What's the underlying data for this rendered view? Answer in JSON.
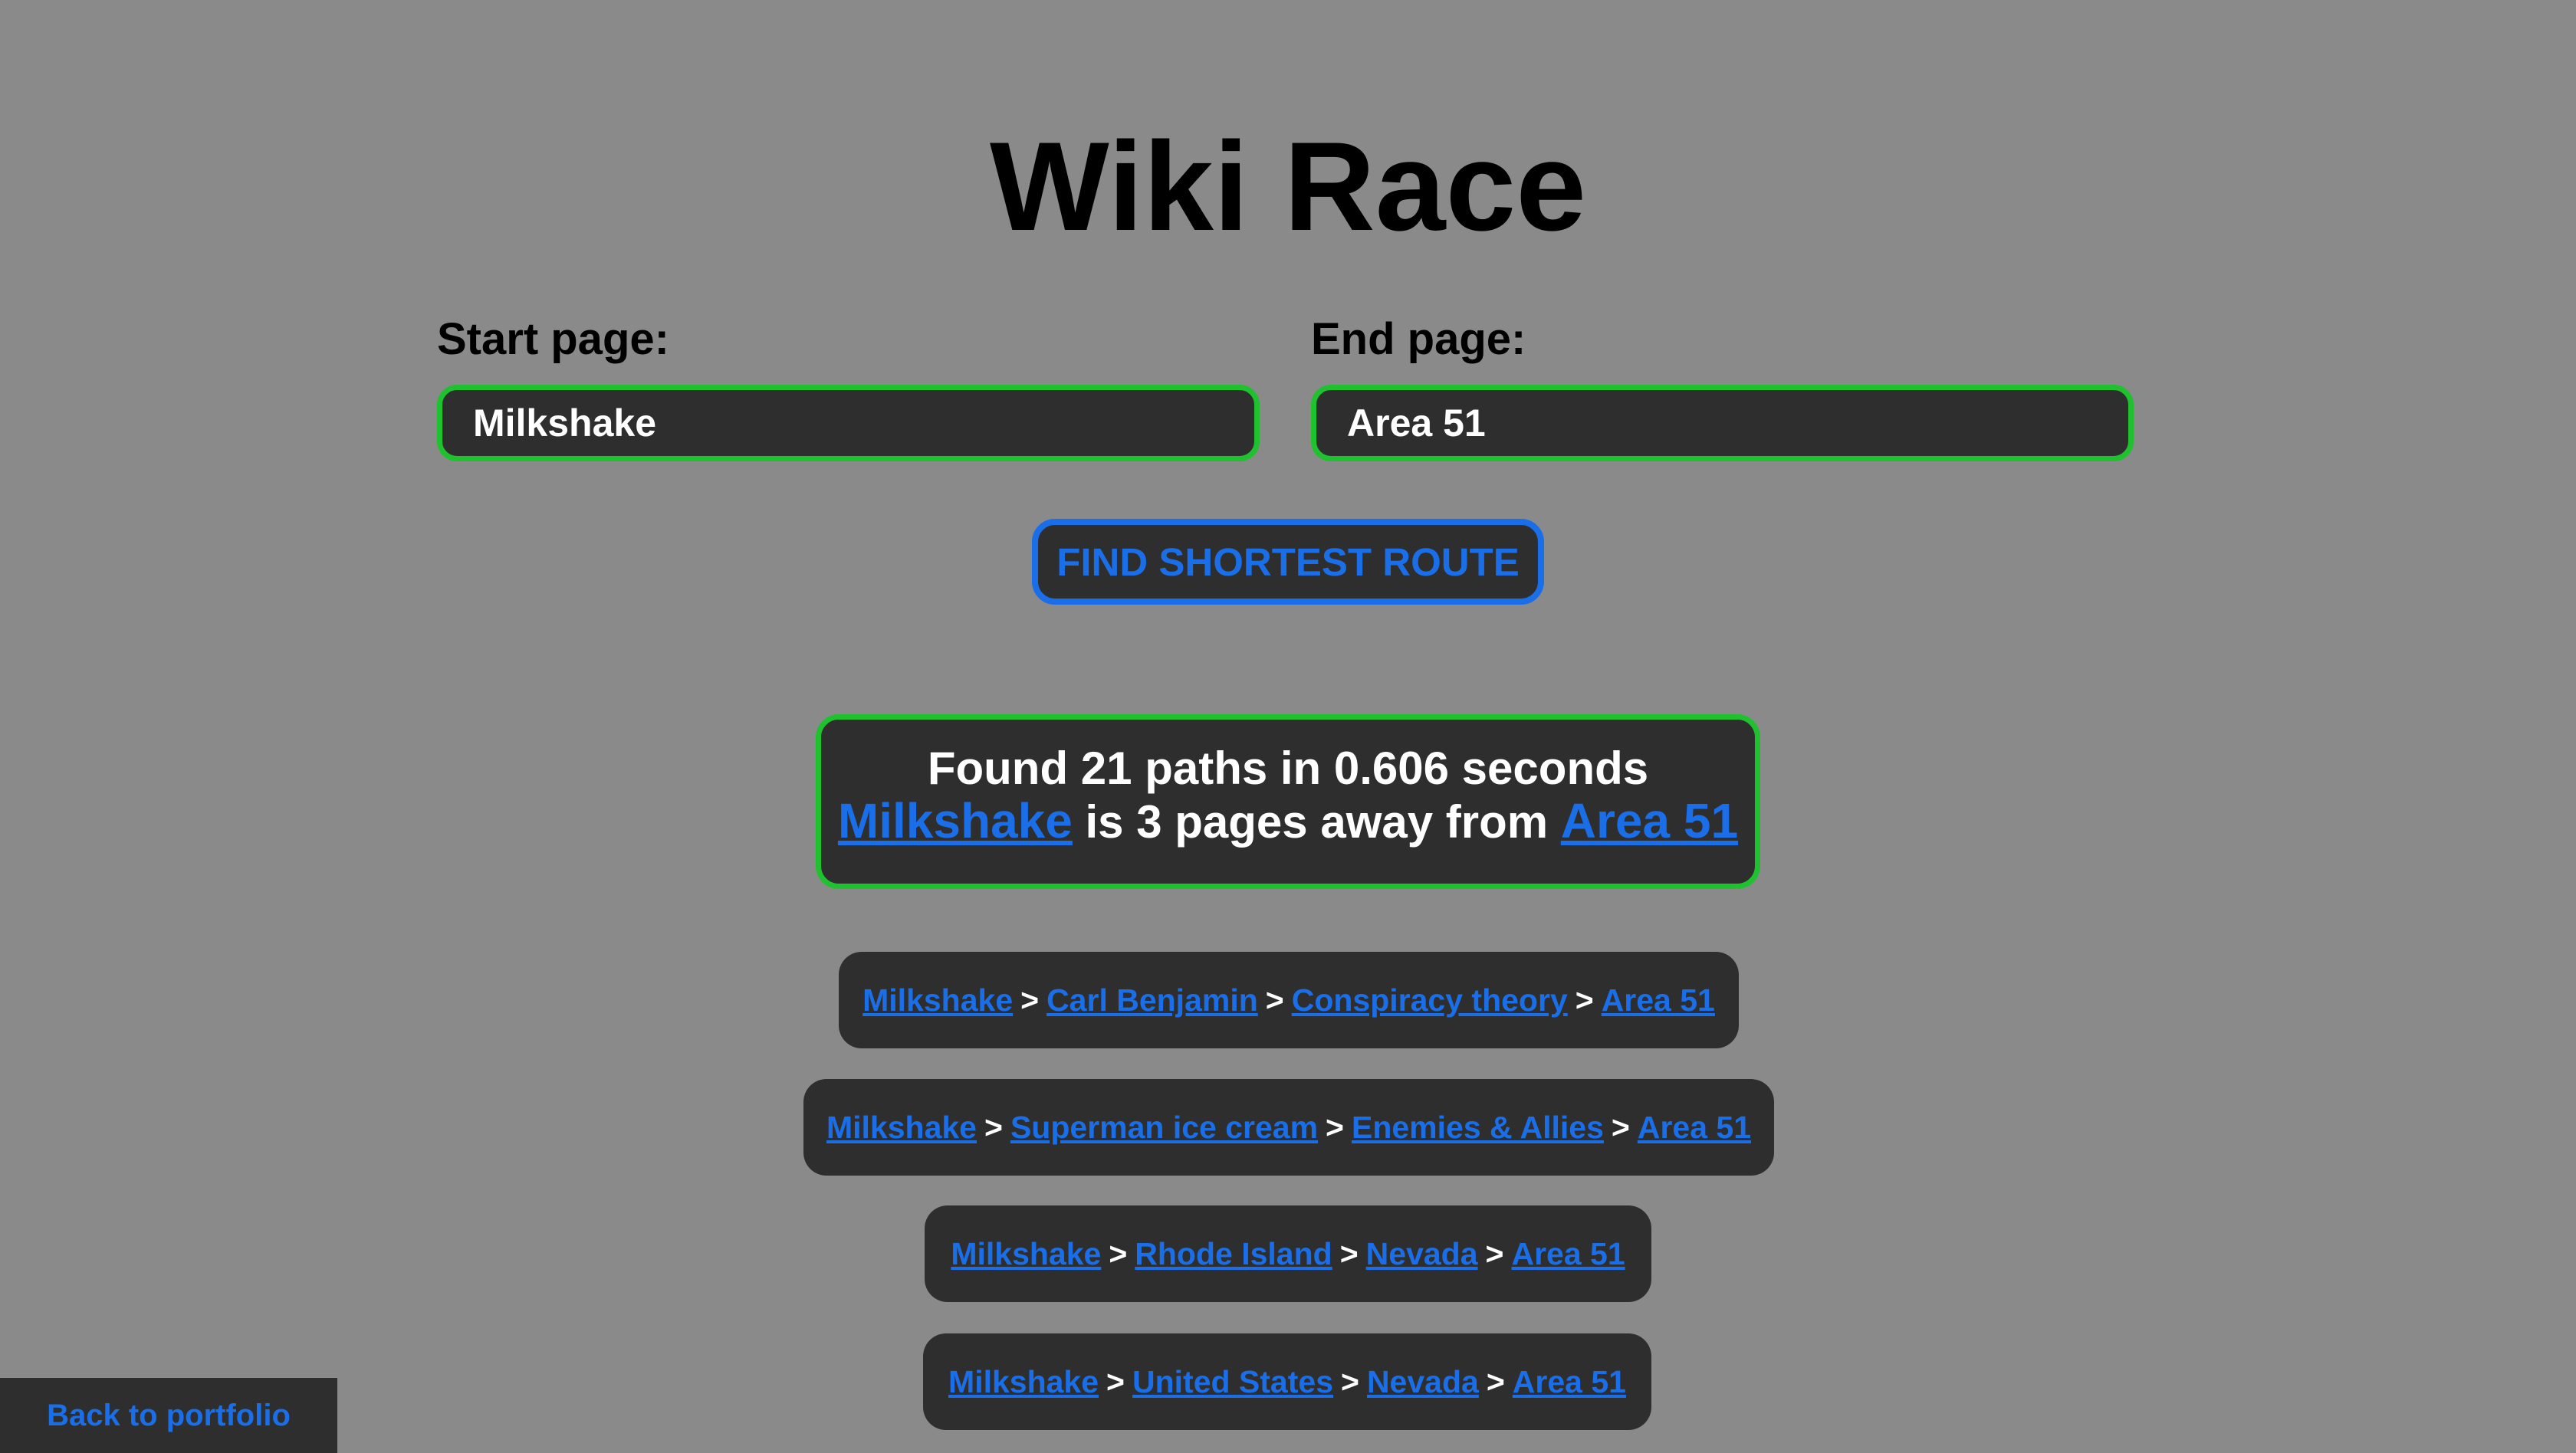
{
  "title": "Wiki Race",
  "start": {
    "label": "Start page:",
    "value": "Milkshake"
  },
  "end": {
    "label": "End page:",
    "value": "Area 51"
  },
  "find_button_label": "FIND SHORTEST ROUTE",
  "result": {
    "summary": "Found 21 paths in 0.606 seconds",
    "start_link": "Milkshake",
    "distance_text": "is 3 pages away from",
    "end_link": "Area 51"
  },
  "separator": ">",
  "paths": [
    [
      "Milkshake",
      "Carl Benjamin",
      "Conspiracy theory",
      "Area 51"
    ],
    [
      "Milkshake",
      "Superman ice cream",
      "Enemies & Allies",
      "Area 51"
    ],
    [
      "Milkshake",
      "Rhode Island",
      "Nevada",
      "Area 51"
    ],
    [
      "Milkshake",
      "United States",
      "Nevada",
      "Area 51"
    ]
  ],
  "back_link": "Back to portfolio",
  "colors": {
    "background": "#8a8a8a",
    "panel": "#2e2e2e",
    "success_border": "#1fc22e",
    "link": "#1a6fe8"
  }
}
